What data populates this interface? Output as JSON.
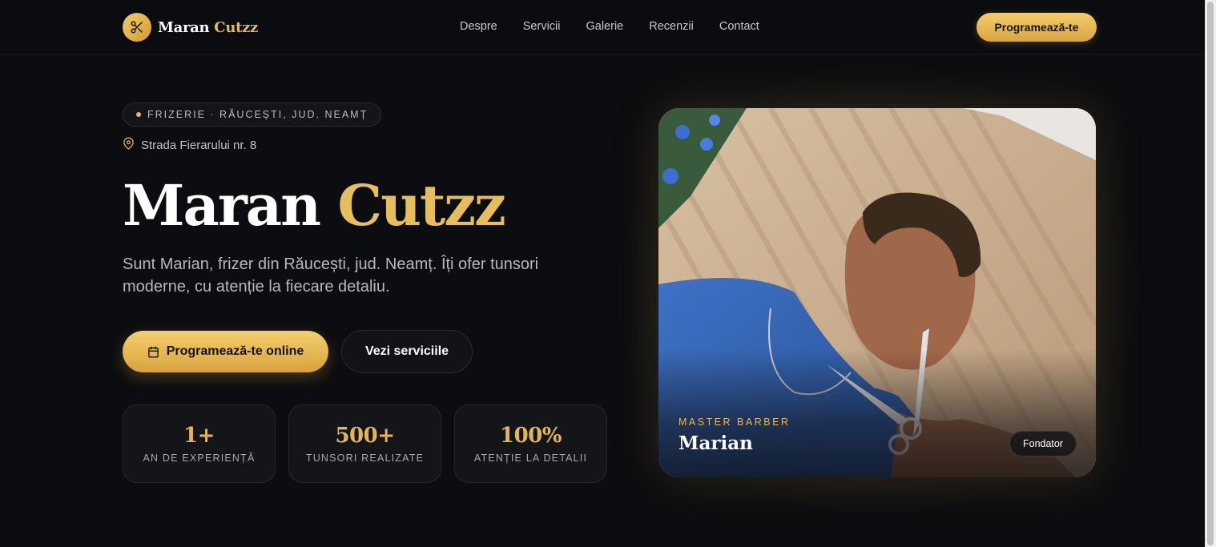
{
  "header": {
    "brand_first": "Maran",
    "brand_second": "Cutzz",
    "nav": [
      "Despre",
      "Servicii",
      "Galerie",
      "Recenzii",
      "Contact"
    ],
    "cta": "Programează-te"
  },
  "hero": {
    "pill": "FRIZERIE · RĂUCEȘTI, JUD. NEAMȚ",
    "address": "Strada Fierarului nr. 8",
    "title_first": "Maran",
    "title_second": "Cutzz",
    "description": "Sunt Marian, frizer din Răucești, jud. Neamț. Îți ofer tunsori moderne, cu atenție la fiecare detaliu.",
    "primary_button": "Programează-te online",
    "secondary_button": "Vezi serviciile",
    "stats": [
      {
        "value": "1+",
        "label": "AN DE EXPERIENȚĂ"
      },
      {
        "value": "500+",
        "label": "TUNSORI REALIZATE"
      },
      {
        "value": "100%",
        "label": "ATENȚIE LA DETALII"
      }
    ]
  },
  "photo_card": {
    "role": "MASTER BARBER",
    "name": "Marian",
    "badge": "Fondator"
  },
  "icons": {
    "logo": "scissors-icon",
    "address": "map-pin-icon",
    "primary_button": "calendar-icon"
  },
  "colors": {
    "background": "#0c0d10",
    "accent_gold": "#e6b955",
    "text": "#ffffff"
  }
}
